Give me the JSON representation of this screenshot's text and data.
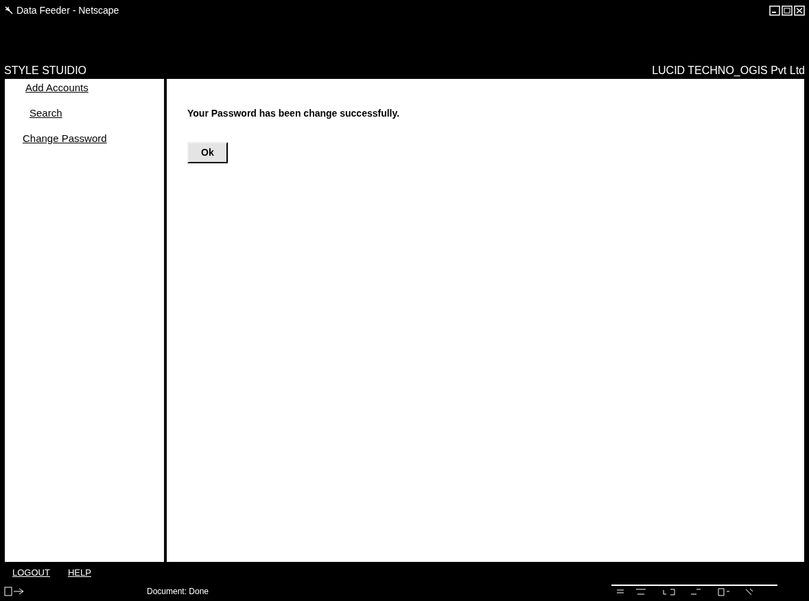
{
  "window": {
    "title": "Data Feeder - Netscape"
  },
  "header": {
    "left": "STYLE STUIDIO",
    "right": "LUCID TECHNO_OGIS Pvt Ltd"
  },
  "sidebar": {
    "items": [
      {
        "label": "Add Accounts"
      },
      {
        "label": "Search"
      },
      {
        "label": "Change Password"
      }
    ]
  },
  "content": {
    "message": "Your Password has been change successfully.",
    "button": "Ok"
  },
  "footer": {
    "links": [
      "LOGOUT",
      "HELP"
    ]
  },
  "status_bar": {
    "text": "Document: Done"
  }
}
